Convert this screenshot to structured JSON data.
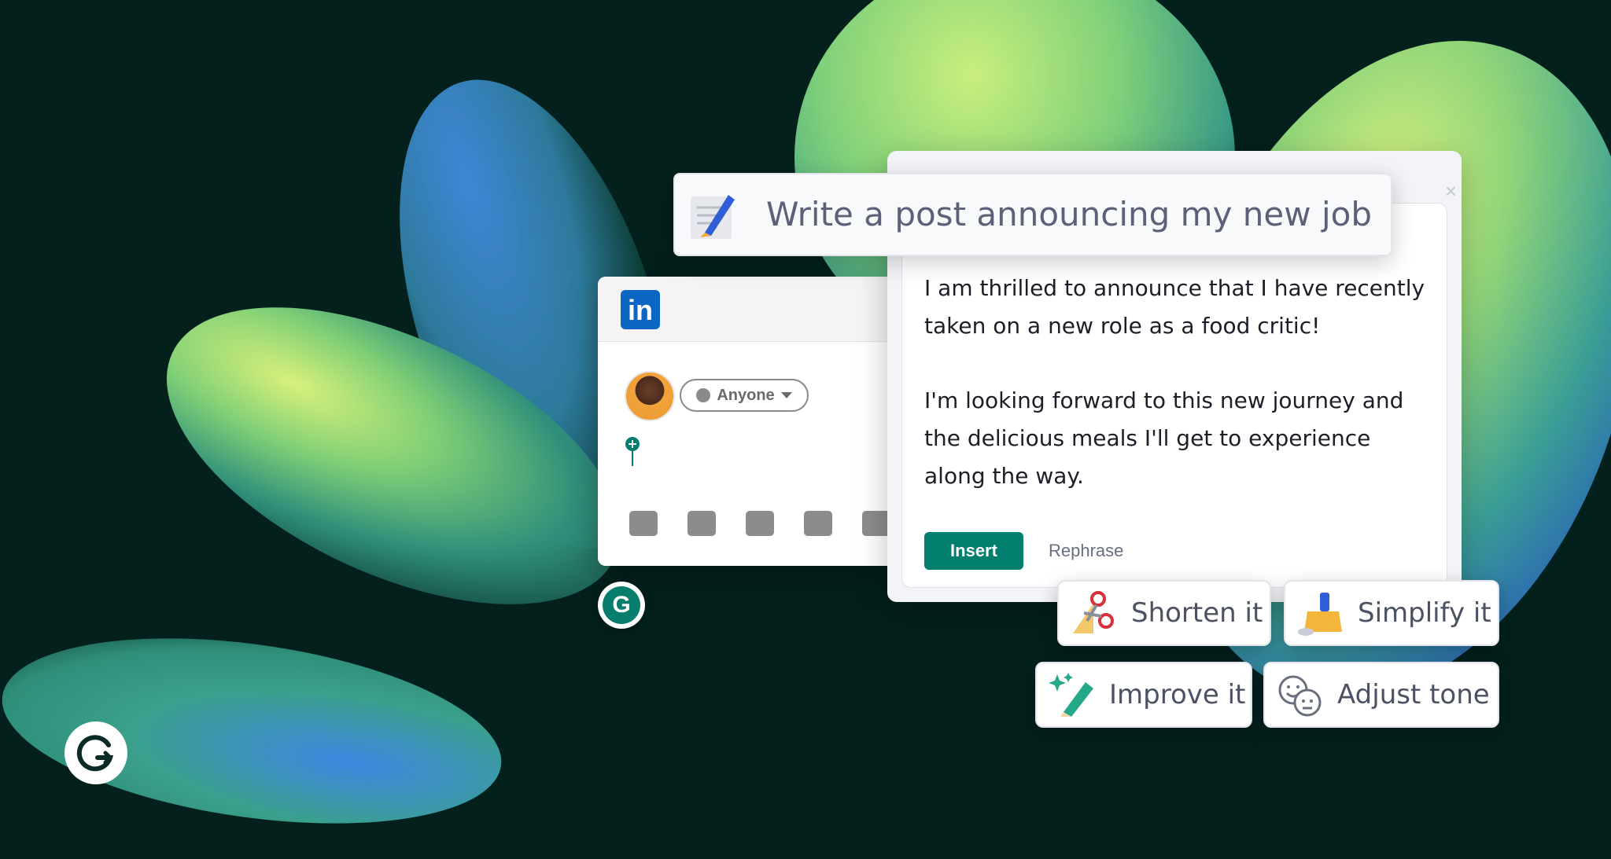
{
  "prompt": {
    "text": "Write a post announcing my new job"
  },
  "ai_panel": {
    "paragraph1": "I am thrilled to announce that I have recently taken on a new role as a food critic!",
    "paragraph2": "I'm looking forward to this new journey and the delicious meals I'll get to experience along the way.",
    "insert_label": "Insert",
    "rephrase_label": "Rephrase",
    "close_symbol": "×"
  },
  "linkedin_card": {
    "logo_text": "in",
    "visibility_label": "Anyone"
  },
  "grammarly": {
    "button_letter": "G"
  },
  "chips": {
    "shorten": "Shorten it",
    "simplify": "Simplify it",
    "improve": "Improve it",
    "adjust": "Adjust tone"
  },
  "colors": {
    "background": "#03201d",
    "grammarly_green": "#027e6f",
    "linkedin_blue": "#0a66c2"
  }
}
